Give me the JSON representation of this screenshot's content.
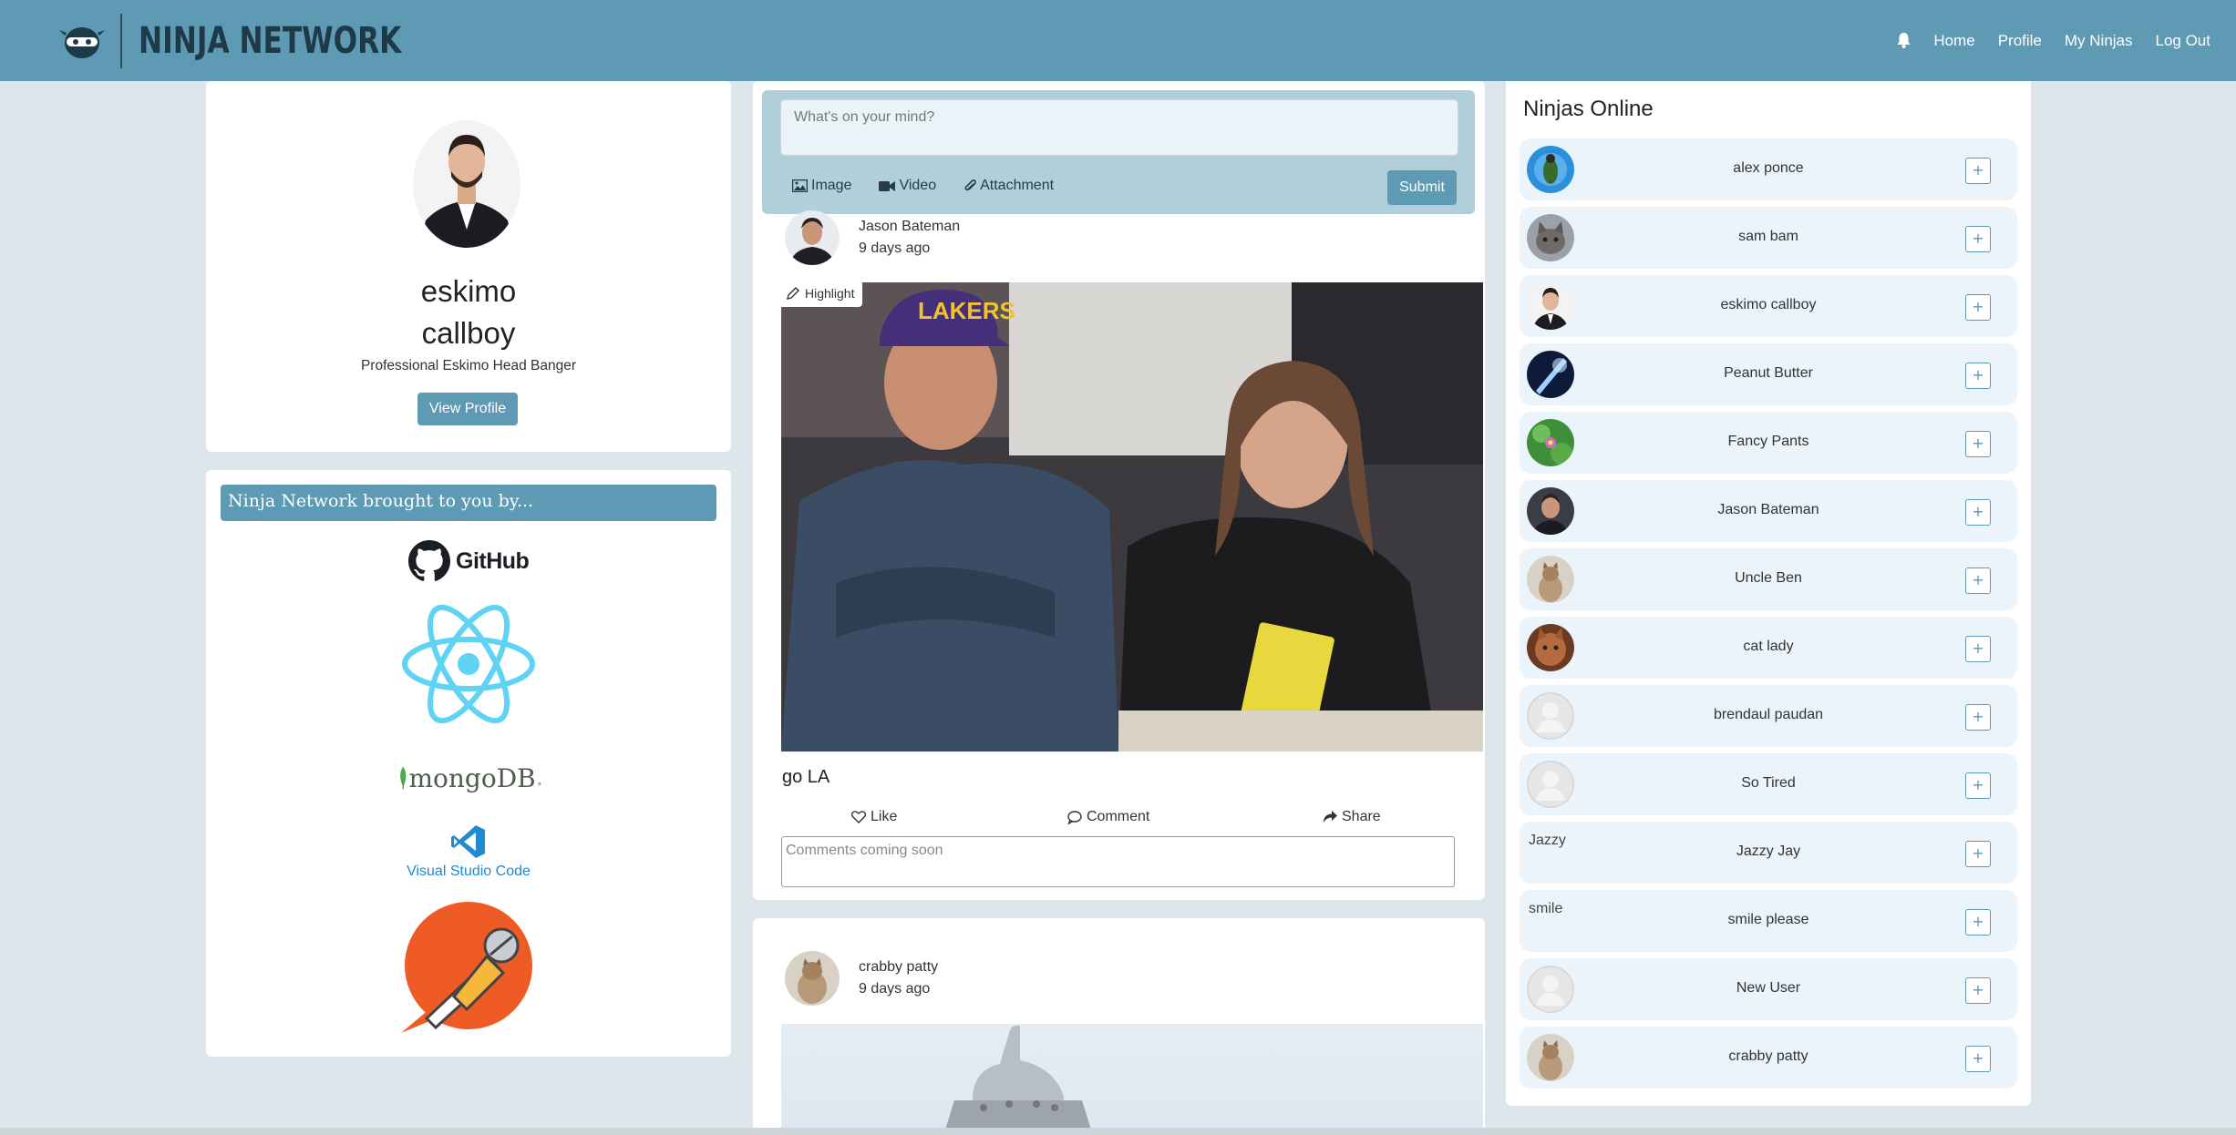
{
  "nav": {
    "brand": "NINJA NETWORK",
    "links": [
      "Home",
      "Profile",
      "My Ninjas",
      "Log Out"
    ]
  },
  "profile": {
    "name_line1": "eskimo",
    "name_line2": "callboy",
    "tagline": "Professional Eskimo Head Banger",
    "view_profile": "View Profile"
  },
  "sponsors": {
    "header": "Ninja Network brought to you by...",
    "github": "GitHub",
    "mongo": "mongoDB",
    "mongo_dot": ".",
    "vscode": "Visual Studio Code"
  },
  "composer": {
    "placeholder": "What's on your mind?",
    "tools": [
      "Image",
      "Video",
      "Attachment"
    ],
    "submit": "Submit"
  },
  "posts": [
    {
      "author": "Jason Bateman",
      "time": "9 days ago",
      "highlight": "Highlight",
      "caption": "go LA",
      "actions": [
        "Like",
        "Comment",
        "Share"
      ],
      "comment_placeholder": "Comments coming soon"
    },
    {
      "author": "crabby patty",
      "time": "9 days ago"
    }
  ],
  "online": {
    "title": "Ninjas Online",
    "users": [
      {
        "name": "alex ponce",
        "avatar": "blue-bird"
      },
      {
        "name": "sam bam",
        "avatar": "cat"
      },
      {
        "name": "eskimo callboy",
        "avatar": "man-suit"
      },
      {
        "name": "Peanut Butter",
        "avatar": "dark-blue"
      },
      {
        "name": "Fancy Pants",
        "avatar": "green-flower"
      },
      {
        "name": "Jason Bateman",
        "avatar": "man-dark"
      },
      {
        "name": "Uncle Ben",
        "avatar": "kitten"
      },
      {
        "name": "cat lady",
        "avatar": "brown-cat"
      },
      {
        "name": "brendaul paudan",
        "avatar": "placeholder"
      },
      {
        "name": "So Tired",
        "avatar": "placeholder"
      },
      {
        "name": "Jazzy Jay",
        "avatar": "broken",
        "alt": "Jazzy"
      },
      {
        "name": "smile please",
        "avatar": "broken",
        "alt": "smile"
      },
      {
        "name": "New User",
        "avatar": "placeholder"
      },
      {
        "name": "crabby patty",
        "avatar": "kitten"
      }
    ],
    "add_label": "+"
  },
  "colors": {
    "nav": "#5f9ab5",
    "page_bg": "#dde6ea",
    "accent": "#5f9ab5",
    "item_bg": "#ebf4fa"
  }
}
